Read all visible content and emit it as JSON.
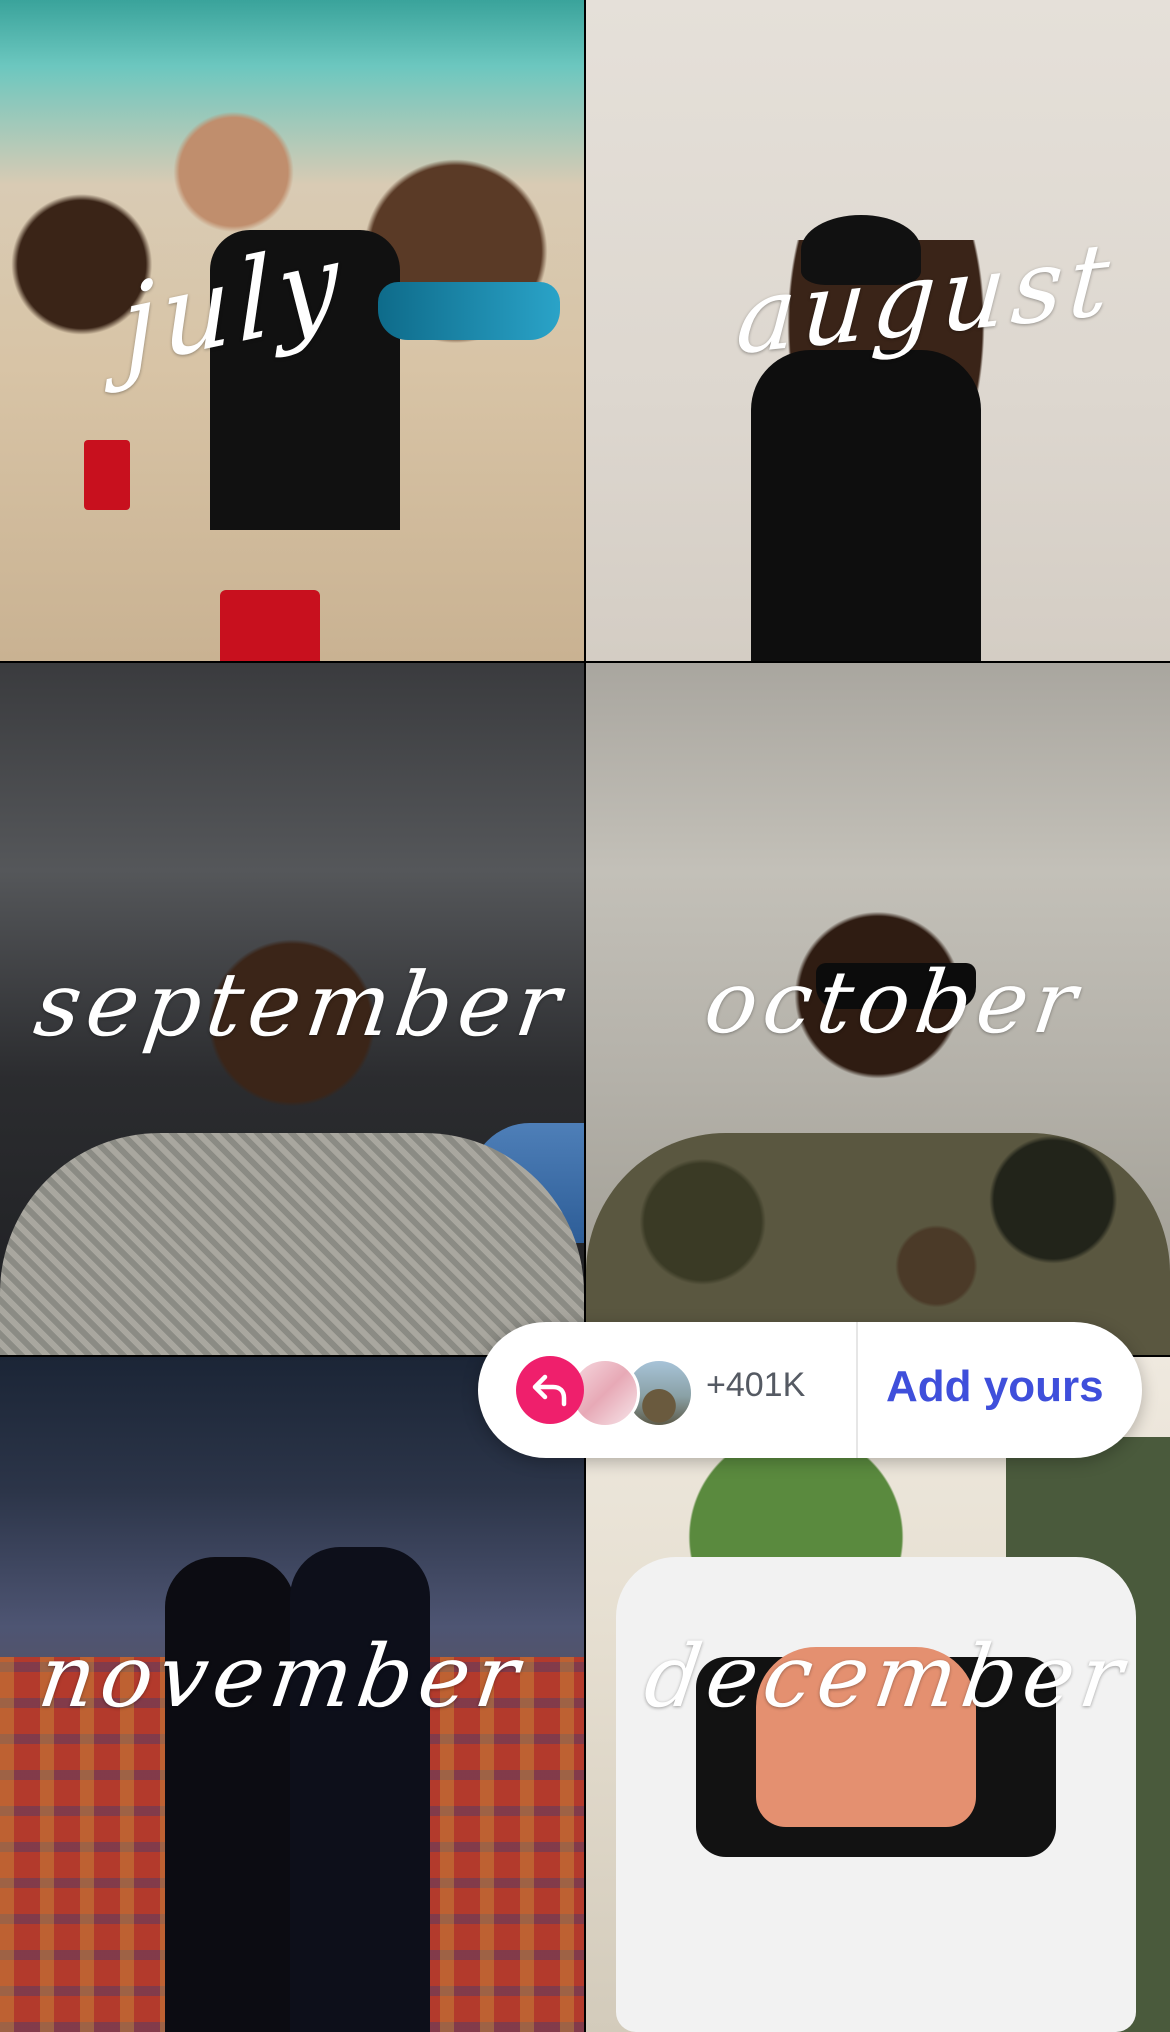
{
  "tiles": [
    {
      "month": "july"
    },
    {
      "month": "august"
    },
    {
      "month": "september"
    },
    {
      "month": "october"
    },
    {
      "month": "november"
    },
    {
      "month": "december"
    }
  ],
  "add_yours": {
    "count": "+401K",
    "button_label": "Add yours",
    "icons": {
      "reply": "reply-arrow-icon"
    },
    "colors": {
      "reply_bg": "#ef1f6c",
      "button_text": "#3f4fdb",
      "count_text": "#555a63"
    }
  }
}
